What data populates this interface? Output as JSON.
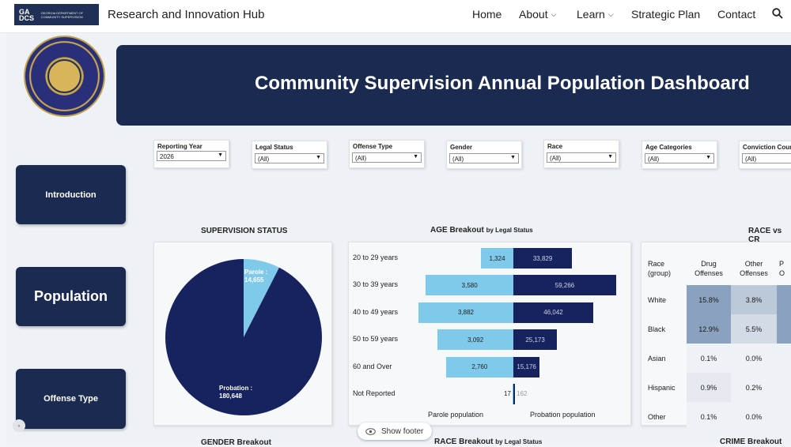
{
  "header": {
    "logo_mark": "GA DCS",
    "logo_text": "GEORGIA DEPARTMENT OF COMMUNITY SUPERVISION",
    "site_title": "Research and Innovation Hub",
    "nav": [
      {
        "label": "Home"
      },
      {
        "label": "About"
      },
      {
        "label": "Learn"
      },
      {
        "label": "Strategic Plan"
      },
      {
        "label": "Contact"
      }
    ]
  },
  "dashboard": {
    "title": "Community Supervision Annual Population Dashboard",
    "filters": [
      {
        "label": "Reporting Year",
        "value": "2026"
      },
      {
        "label": "Legal Status",
        "value": "(All)"
      },
      {
        "label": "Offense Type",
        "value": "(All)"
      },
      {
        "label": "Gender",
        "value": "(All)"
      },
      {
        "label": "Race",
        "value": "(All)"
      },
      {
        "label": "Age Categories",
        "value": "(All)"
      },
      {
        "label": "Conviction Cour",
        "value": "(All)"
      }
    ],
    "side_nav": {
      "introduction": "Introduction",
      "population": "Population",
      "offense_type": "Offense Type"
    },
    "supervision_status": {
      "title": "SUPERVISION STATUS",
      "parole_label": "Parole :",
      "parole_value": "14,655",
      "probation_label": "Probation :",
      "probation_value": "180,648"
    },
    "age_breakout": {
      "title": "AGE Breakout",
      "subtitle": "by Legal Status",
      "legend_parole": "Parole population",
      "legend_probation": "Probation population"
    },
    "race_vs": {
      "title": "RACE vs CR",
      "col_race": "Race (group)",
      "col_drug": "Drug Offenses",
      "col_other": "Other Offenses",
      "col_p": "P O"
    },
    "bottom": {
      "gender": "GENDER Breakout",
      "race": "RACE Breakout",
      "race_sub": "by Legal Status",
      "crime": "CRIME Breakout"
    },
    "footer_button": "Show footer"
  },
  "chart_data": [
    {
      "type": "pie",
      "title": "SUPERVISION STATUS",
      "categories": [
        "Parole",
        "Probation"
      ],
      "values": [
        14655,
        180648
      ],
      "colors": [
        "#7fc9ea",
        "#16235f"
      ]
    },
    {
      "type": "bar",
      "title": "AGE Breakout",
      "subtitle": "by Legal Status",
      "categories": [
        "20 to 29 years",
        "30 to 39 years",
        "40 to 49 years",
        "50 to 59 years",
        "60 and Over",
        "Not Reported"
      ],
      "series": [
        {
          "name": "Parole population",
          "values": [
            1324,
            3580,
            3882,
            3092,
            2760,
            17
          ],
          "labels": [
            "1,324",
            "3,580",
            "3,882",
            "3,092",
            "2,760",
            "17"
          ],
          "color": "#7fc9ea"
        },
        {
          "name": "Probation population",
          "values": [
            33829,
            59266,
            46042,
            25173,
            15176,
            162
          ],
          "labels": [
            "33,829",
            "59,266",
            "46,042",
            "25,173",
            "15,176",
            "162"
          ],
          "color": "#16235f"
        }
      ]
    },
    {
      "type": "heatmap",
      "title": "RACE vs CR",
      "rows": [
        "White",
        "Black",
        "Asian",
        "Hispanic",
        "Other"
      ],
      "columns": [
        "Drug Offenses",
        "Other Offenses"
      ],
      "values": [
        [
          "15.8%",
          "3.8%"
        ],
        [
          "12.9%",
          "5.5%"
        ],
        [
          "0.1%",
          "0.0%"
        ],
        [
          "0.9%",
          "0.2%"
        ],
        [
          "0.1%",
          "0.0%"
        ]
      ],
      "cell_colors": [
        [
          "#8aa2c0",
          "#bcc9d8"
        ],
        [
          "#8aa2c0",
          "#d2dbe6"
        ],
        [
          "#eef1f5",
          "#eef1f5"
        ],
        [
          "#e6eaf0",
          "#eef1f5"
        ],
        [
          "#eef1f5",
          "#eef1f5"
        ]
      ]
    }
  ]
}
